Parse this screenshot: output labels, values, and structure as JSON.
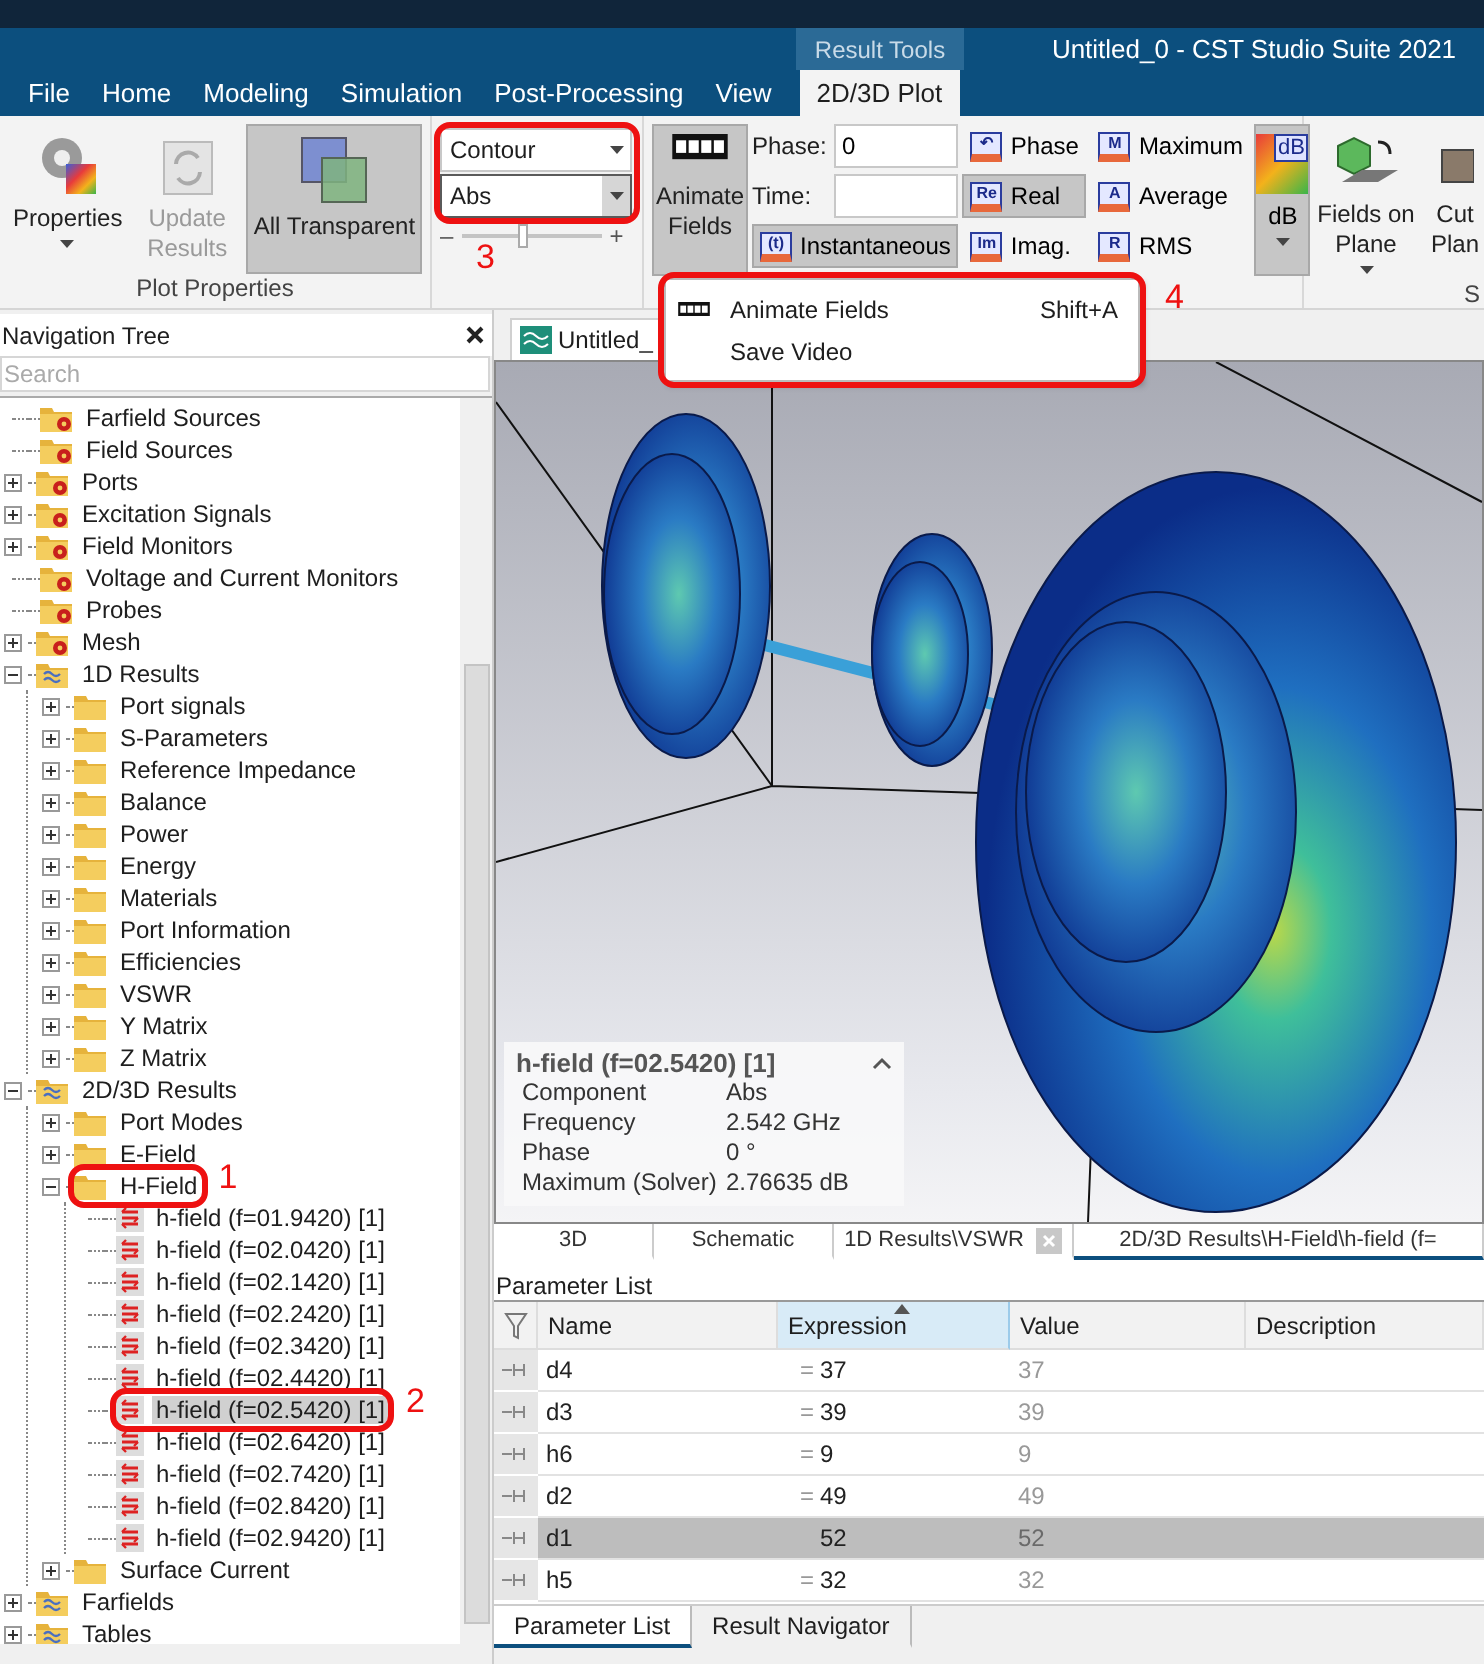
{
  "title_bar": {
    "context_tab": "Result Tools",
    "title": "Untitled_0 - CST Studio Suite 2021"
  },
  "menu_tabs": [
    {
      "label": "File",
      "selected": false
    },
    {
      "label": "Home",
      "selected": false
    },
    {
      "label": "Modeling",
      "selected": false
    },
    {
      "label": "Simulation",
      "selected": false
    },
    {
      "label": "Post-Processing",
      "selected": false
    },
    {
      "label": "View",
      "selected": false
    },
    {
      "label": "2D/3D Plot",
      "selected": true
    }
  ],
  "ribbon": {
    "plot_properties": {
      "group_label": "Plot Properties",
      "buttons": [
        {
          "kind": "properties",
          "label": "Properties",
          "disabled": false,
          "active": false
        },
        {
          "kind": "update",
          "label": "Update Results",
          "disabled": true,
          "active": false
        },
        {
          "kind": "transparent",
          "label": "All Transparent",
          "disabled": false,
          "active": true
        }
      ]
    },
    "plot_type": {
      "callout": "3",
      "selects": [
        "Contour",
        "Abs"
      ],
      "minus": "–",
      "plus": "+",
      "level": 0.45
    },
    "animation": {
      "animate": {
        "label": "Animate Fields",
        "active": true
      },
      "phase": {
        "label": "Phase:",
        "value": "0"
      },
      "time": {
        "label": "Time:"
      },
      "instantaneous": {
        "badge": "(t)",
        "label": "Instantaneous",
        "active": true
      },
      "complex": [
        {
          "badge": "↶",
          "label": "Phase",
          "active": false
        },
        {
          "badge": "Re",
          "label": "Real",
          "active": true
        },
        {
          "badge": "Im",
          "label": "Imag.",
          "active": false
        }
      ],
      "reductions": [
        {
          "badge": "M",
          "label": "Maximum"
        },
        {
          "badge": "A",
          "label": "Average"
        },
        {
          "badge": "R",
          "label": "RMS"
        }
      ],
      "db": {
        "badge": "dB",
        "label": "dB",
        "active": true
      }
    },
    "planes": {
      "group_label": "S",
      "buttons": [
        {
          "kind": "fields_on_plane",
          "label": "Fields on Plane"
        },
        {
          "kind": "cut_plane",
          "label": "Cut Plan"
        }
      ]
    }
  },
  "animate_menu": {
    "callout": "4",
    "items": [
      {
        "kind": "film",
        "label": "Animate Fields",
        "shortcut": "Shift+A"
      },
      {
        "kind": "plain",
        "label": "Save Video"
      }
    ]
  },
  "navigation": {
    "title": "Navigation Tree",
    "search_placeholder": "Search",
    "tree": [
      {
        "label": "Farfield Sources",
        "kind": "gear_folder"
      },
      {
        "label": "Field Sources",
        "kind": "gear_folder"
      },
      {
        "label": "Ports",
        "kind": "gear_folder",
        "expanded": false
      },
      {
        "label": "Excitation Signals",
        "kind": "gear_folder",
        "expanded": false
      },
      {
        "label": "Field Monitors",
        "kind": "gear_folder",
        "expanded": false
      },
      {
        "label": "Voltage and Current Monitors",
        "kind": "gear_folder"
      },
      {
        "label": "Probes",
        "kind": "gear_folder"
      },
      {
        "label": "Mesh",
        "kind": "gear_folder",
        "expanded": false
      },
      {
        "label": "1D Results",
        "kind": "result_folder",
        "expanded": true,
        "children": [
          {
            "label": "Port signals",
            "kind": "folder",
            "expanded": false
          },
          {
            "label": "S-Parameters",
            "kind": "folder",
            "expanded": false
          },
          {
            "label": "Reference Impedance",
            "kind": "folder",
            "expanded": false
          },
          {
            "label": "Balance",
            "kind": "folder",
            "expanded": false
          },
          {
            "label": "Power",
            "kind": "folder",
            "expanded": false
          },
          {
            "label": "Energy",
            "kind": "folder",
            "expanded": false
          },
          {
            "label": "Materials",
            "kind": "folder",
            "expanded": false
          },
          {
            "label": "Port Information",
            "kind": "folder",
            "expanded": false
          },
          {
            "label": "Efficiencies",
            "kind": "folder",
            "expanded": false
          },
          {
            "label": "VSWR",
            "kind": "folder",
            "expanded": false
          },
          {
            "label": "Y Matrix",
            "kind": "folder",
            "expanded": false
          },
          {
            "label": "Z Matrix",
            "kind": "folder",
            "expanded": false
          }
        ]
      },
      {
        "label": "2D/3D Results",
        "kind": "result_folder",
        "expanded": true,
        "children": [
          {
            "label": "Port Modes",
            "kind": "folder",
            "expanded": false
          },
          {
            "label": "E-Field",
            "kind": "folder",
            "expanded": false
          },
          {
            "label": "H-Field",
            "kind": "folder",
            "expanded": true,
            "callout": "1",
            "children": [
              {
                "label": "h-field (f=01.9420) [1]",
                "kind": "field",
                "selected": false
              },
              {
                "label": "h-field (f=02.0420) [1]",
                "kind": "field",
                "selected": false
              },
              {
                "label": "h-field (f=02.1420) [1]",
                "kind": "field",
                "selected": false
              },
              {
                "label": "h-field (f=02.2420) [1]",
                "kind": "field",
                "selected": false
              },
              {
                "label": "h-field (f=02.3420) [1]",
                "kind": "field",
                "selected": false
              },
              {
                "label": "h-field (f=02.4420) [1]",
                "kind": "field",
                "selected": false
              },
              {
                "label": "h-field (f=02.5420) [1]",
                "kind": "field",
                "selected": true,
                "callout": "2"
              },
              {
                "label": "h-field (f=02.6420) [1]",
                "kind": "field",
                "selected": false
              },
              {
                "label": "h-field (f=02.7420) [1]",
                "kind": "field",
                "selected": false
              },
              {
                "label": "h-field (f=02.8420) [1]",
                "kind": "field",
                "selected": false
              },
              {
                "label": "h-field (f=02.9420) [1]",
                "kind": "field",
                "selected": false
              }
            ]
          },
          {
            "label": "Surface Current",
            "kind": "folder",
            "expanded": false
          }
        ]
      },
      {
        "label": "Farfields",
        "kind": "result_folder",
        "expanded": false
      },
      {
        "label": "Tables",
        "kind": "result_folder",
        "expanded": false
      }
    ]
  },
  "document_tab": {
    "label": "Untitled_"
  },
  "view_info": {
    "title": "h-field (f=02.5420) [1]",
    "rows": [
      {
        "label": "Component",
        "value": "Abs"
      },
      {
        "label": "Frequency",
        "value": "2.542 GHz"
      },
      {
        "label": "Phase",
        "value": "0 °"
      },
      {
        "label": "Maximum (Solver)",
        "value": "2.76635 dB"
      }
    ]
  },
  "view_tabs": [
    {
      "label": "3D",
      "selected": false,
      "closable": false
    },
    {
      "label": "Schematic",
      "selected": false,
      "closable": false
    },
    {
      "label": "1D Results\\VSWR",
      "selected": false,
      "closable": true
    },
    {
      "label": "2D/3D Results\\H-Field\\h-field (f=",
      "selected": true,
      "closable": false
    }
  ],
  "parameter_list": {
    "title": "Parameter List",
    "columns": [
      {
        "label": "Name",
        "sorted": false
      },
      {
        "label": "Expression",
        "sorted": true
      },
      {
        "label": "Value",
        "sorted": false
      },
      {
        "label": "Description",
        "sorted": false
      }
    ],
    "rows": [
      {
        "name": "d4",
        "sign": "=",
        "expression": "37",
        "value": "37",
        "selected": false
      },
      {
        "name": "d3",
        "sign": "=",
        "expression": "39",
        "value": "39",
        "selected": false
      },
      {
        "name": "h6",
        "sign": "=",
        "expression": "9",
        "value": "9",
        "selected": false
      },
      {
        "name": "d2",
        "sign": "=",
        "expression": "49",
        "value": "49",
        "selected": false
      },
      {
        "name": "d1",
        "expression": "52",
        "value": "52",
        "selected": true
      },
      {
        "name": "h5",
        "sign": "=",
        "expression": "32",
        "value": "32",
        "selected": false
      }
    ]
  },
  "bottom_tabs": [
    {
      "label": "Parameter List",
      "selected": true
    },
    {
      "label": "Result Navigator",
      "selected": false
    }
  ]
}
